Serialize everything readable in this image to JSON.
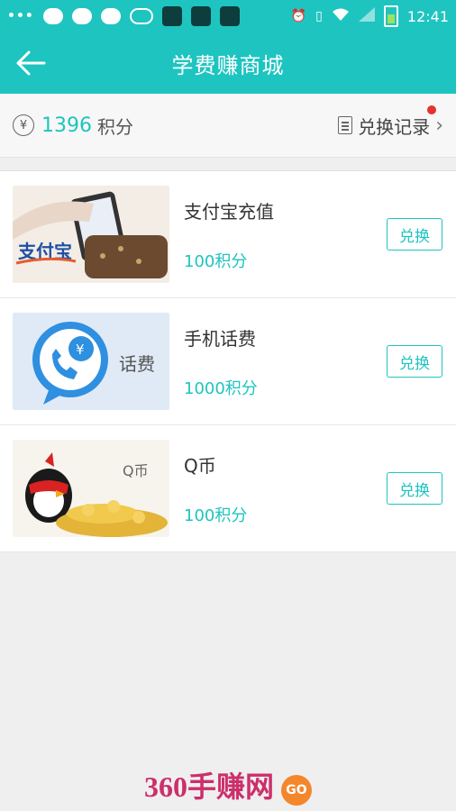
{
  "status": {
    "time": "12:41"
  },
  "header": {
    "title": "学费赚商城"
  },
  "points": {
    "currency_symbol": "¥",
    "value": "1396",
    "unit": "积分",
    "records_label": "兑换记录"
  },
  "items": [
    {
      "name": "支付宝充值",
      "cost": "100积分",
      "button": "兑换",
      "thumb_text": "支付宝"
    },
    {
      "name": "手机话费",
      "cost": "1000积分",
      "button": "兑换",
      "thumb_text": "话费"
    },
    {
      "name": "Q币",
      "cost": "100积分",
      "button": "兑换",
      "thumb_text": "Q币"
    }
  ],
  "watermark": {
    "text": "360手赚网",
    "badge": "GO"
  },
  "colors": {
    "accent": "#1ec4c0",
    "notification": "#e5322d"
  }
}
